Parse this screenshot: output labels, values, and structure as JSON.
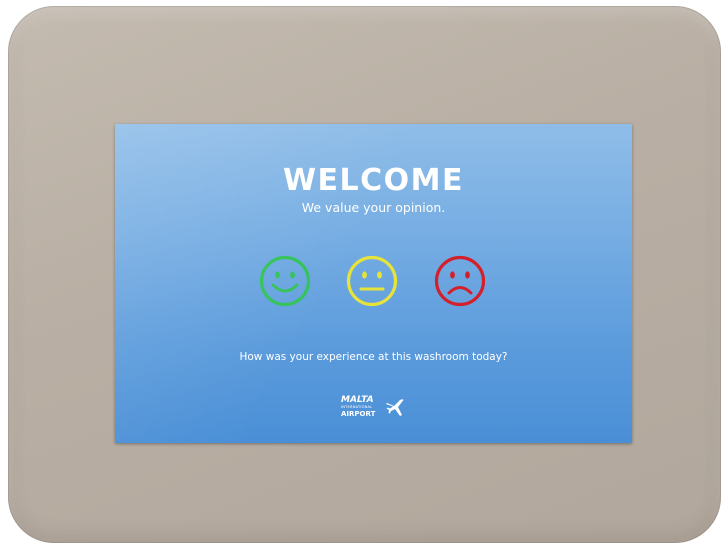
{
  "screen": {
    "title": "WELCOME",
    "subtitle": "We value your opinion.",
    "question": "How was your experience at this washroom today?"
  },
  "faces": [
    {
      "icon": "smiley-happy-icon",
      "color": "#33c25a"
    },
    {
      "icon": "smiley-neutral-icon",
      "color": "#e6e33a"
    },
    {
      "icon": "smiley-sad-icon",
      "color": "#d4202a"
    }
  ],
  "logo": {
    "line1": "MALTA",
    "line2": "INTERNATIONAL",
    "line3": "AIRPORT",
    "icon": "airplane-icon"
  },
  "colors": {
    "screen_top": "#8fbde8",
    "screen_bottom": "#4a8fd6",
    "bezel": "#b9afa4"
  }
}
